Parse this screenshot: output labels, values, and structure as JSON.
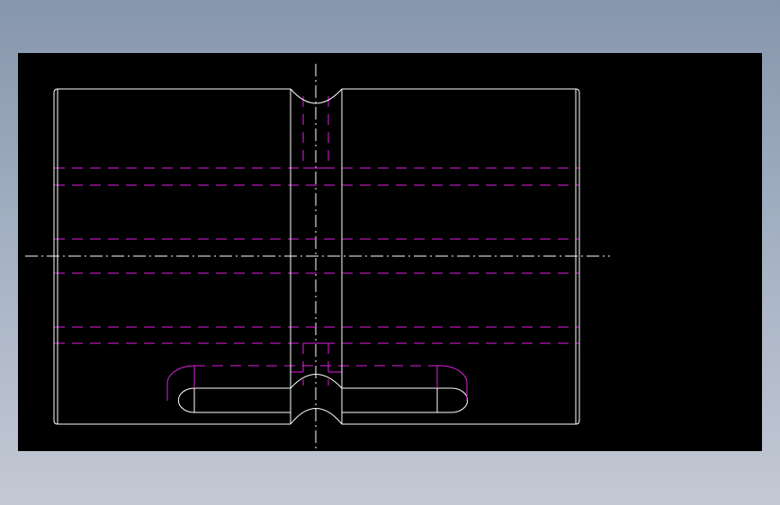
{
  "viewport": {
    "background": "#000000",
    "desktop_gradient": [
      "#8696ac",
      "#c3c9d4"
    ]
  },
  "drawing": {
    "type": "cad-orthographic-view",
    "colors": {
      "outline": "#ffffff",
      "hidden_lines": "#e020e0",
      "center_lines": "#ffffff"
    },
    "line_styles": {
      "outline": "solid",
      "hidden": "dashed",
      "center": "dash-dot"
    }
  }
}
